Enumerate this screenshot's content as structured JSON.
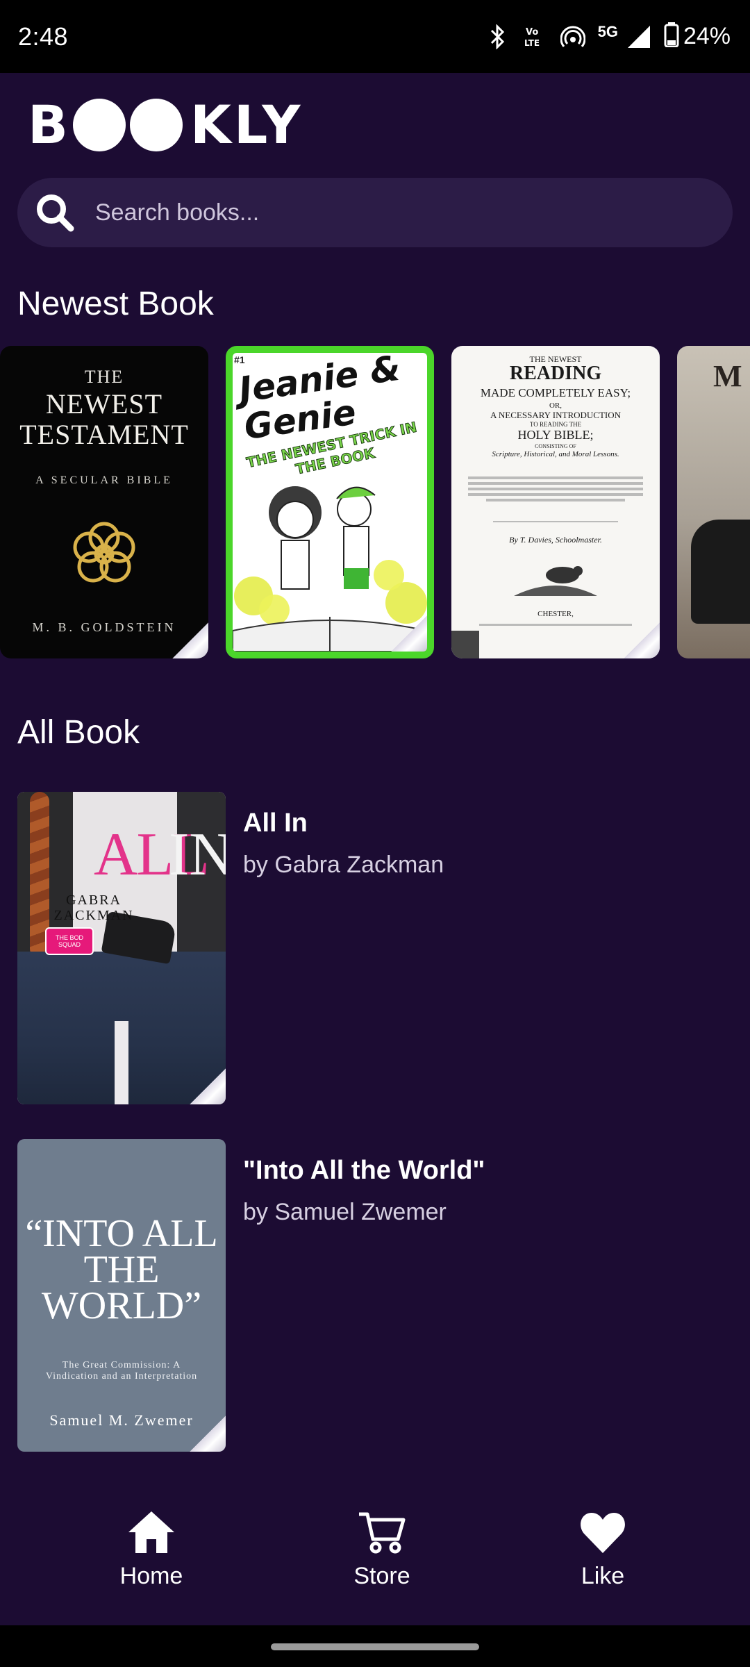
{
  "status_bar": {
    "time": "2:48",
    "network": "5G",
    "volte": "Vo LTE",
    "battery": "24%"
  },
  "app": {
    "logo_prefix": "B",
    "logo_suffix": "KLY"
  },
  "search": {
    "placeholder": "Search books..."
  },
  "sections": {
    "newest_title": "Newest Book",
    "all_title": "All Book"
  },
  "newest_books": [
    {
      "cover_text": [
        "THE",
        "NEWEST TESTAMENT",
        "A SECULAR BIBLE",
        "M. B. GOLDSTEIN"
      ]
    },
    {
      "cover_text": [
        "#1",
        "Jeanie & Genie",
        "THE NEWEST TRICK IN THE BOOK"
      ]
    },
    {
      "cover_text": [
        "THE NEWEST",
        "READING",
        "MADE COMPLETELY EASY;",
        "OR,",
        "A NECESSARY INTRODUCTION",
        "TO READING THE",
        "HOLY BIBLE;",
        "CONSISTING OF",
        "Scripture, Historical, and Moral Lessons.",
        "By T. Davies, Schoolmaster.",
        "CHESTER,"
      ]
    },
    {
      "cover_text": [
        "M"
      ]
    }
  ],
  "all_books": [
    {
      "title": "All In",
      "author": "by Gabra Zackman",
      "cover_text": [
        "ALL",
        "IN",
        "GABRA ZACKMAN",
        "THE BOD SQUAD"
      ]
    },
    {
      "title": "\"Into All the World\"",
      "author": "by Samuel Zwemer",
      "cover_text": [
        "“INTO ALL THE WORLD”",
        "The Great Commission: A Vindication and an Interpretation",
        "Samuel M. Zwemer"
      ]
    }
  ],
  "bottom_nav": {
    "items": [
      {
        "label": "Home",
        "icon": "home-icon"
      },
      {
        "label": "Store",
        "icon": "cart-icon"
      },
      {
        "label": "Like",
        "icon": "heart-icon"
      }
    ]
  },
  "colors": {
    "background": "#1c0c33",
    "search_bg": "#2c1c47",
    "text": "#ffffff"
  }
}
